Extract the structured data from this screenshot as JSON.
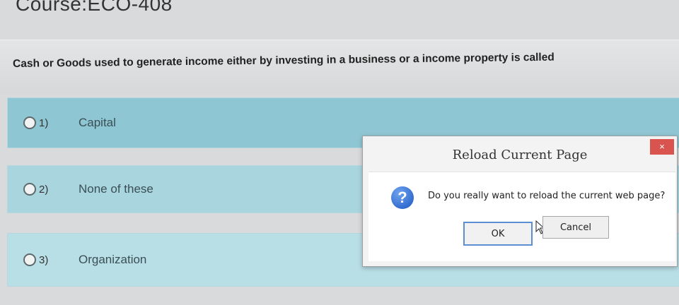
{
  "course": {
    "title": "Course:ECO-408"
  },
  "question": {
    "text": "Cash or Goods used to generate income either by investing in a business or a income property is called"
  },
  "options": [
    {
      "number": "1)",
      "label": "Capital"
    },
    {
      "number": "2)",
      "label": "None of these"
    },
    {
      "number": "3)",
      "label": "Organization"
    }
  ],
  "dialog": {
    "title": "Reload Current Page",
    "close_label": "×",
    "message": "Do you really want to reload the current web page?",
    "icon": "question-icon",
    "ok_label": "OK",
    "cancel_label": "Cancel"
  },
  "colors": {
    "option_bg": "#8ec7d3",
    "close_button": "#d9534f",
    "ok_border": "#5b8fd1"
  }
}
